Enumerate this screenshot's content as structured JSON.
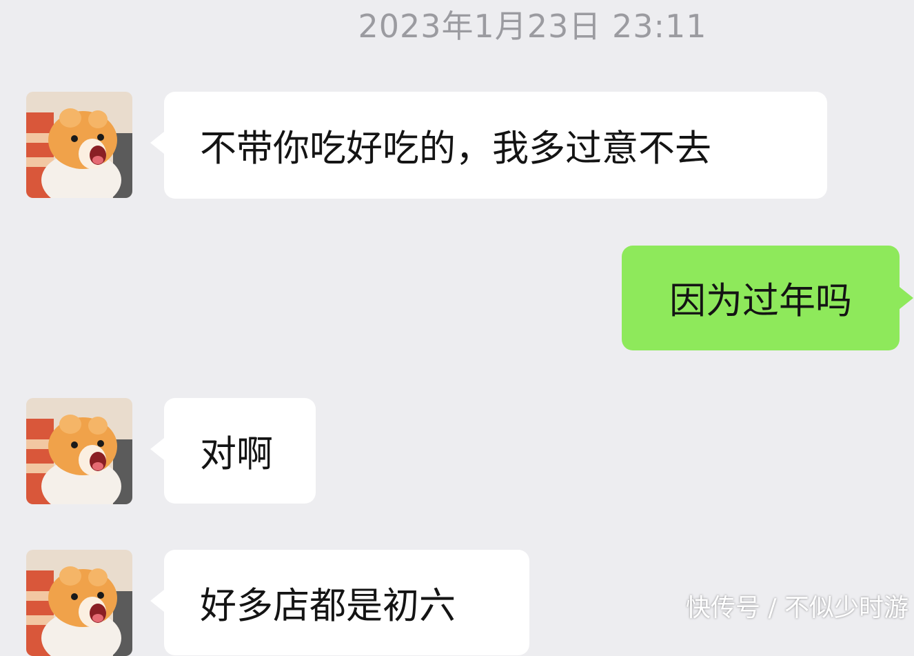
{
  "chat": {
    "timestamp": "2023年1月23日 23:11",
    "messages": [
      {
        "sender": "contact",
        "avatar_icon": "pomeranian-dog-avatar",
        "text": "不带你吃好吃的，我多过意不去"
      },
      {
        "sender": "self",
        "text": "因为过年吗"
      },
      {
        "sender": "contact",
        "avatar_icon": "pomeranian-dog-avatar",
        "text": "对啊"
      },
      {
        "sender": "contact",
        "avatar_icon": "pomeranian-dog-avatar",
        "text": "好多店都是初六"
      }
    ]
  },
  "colors": {
    "background": "#ededf0",
    "incoming_bubble": "#ffffff",
    "outgoing_bubble": "#8ee95b",
    "timestamp_text": "#9b9ba0"
  },
  "watermark": "快传号 / 不似少时游"
}
